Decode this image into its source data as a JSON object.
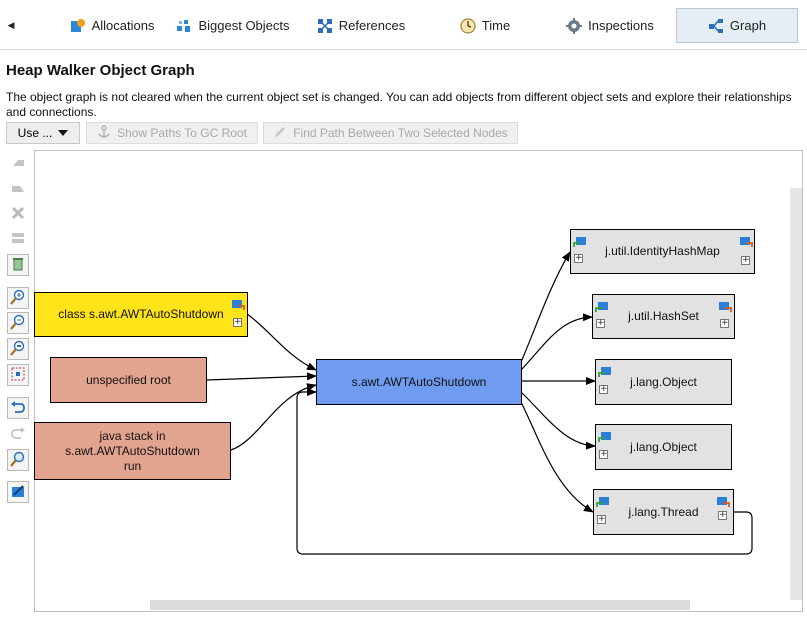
{
  "tabs": [
    {
      "label": "Allocations",
      "icon": "allocations-icon"
    },
    {
      "label": "Biggest Objects",
      "icon": "biggest-objects-icon"
    },
    {
      "label": "References",
      "icon": "references-icon"
    },
    {
      "label": "Time",
      "icon": "clock-icon"
    },
    {
      "label": "Inspections",
      "icon": "gear-icon"
    },
    {
      "label": "Graph",
      "icon": "graph-icon",
      "active": true
    }
  ],
  "page": {
    "title": "Heap Walker Object Graph",
    "description": "The object graph is not cleared when the current object set is changed. You can add objects from different object sets and explore their relationships and connections."
  },
  "toolbar": {
    "use_label": "Use ...",
    "paths_label": "Show Paths To GC Root",
    "find_label": "Find Path Between Two Selected Nodes"
  },
  "side_tools": [
    "back-icon",
    "forward-icon",
    "delete-icon",
    "remove-unselected-icon",
    "clear-graph-icon",
    "zoom-in-icon",
    "zoom-out-icon",
    "zoom-100-icon",
    "fit-content-icon",
    "undo-icon",
    "redo-icon",
    "search-icon",
    "export-icon"
  ],
  "graph": {
    "nodes": {
      "class_awt": "class s.awt.AWTAutoShutdown",
      "unspecified_root": "unspecified root",
      "java_stack_1": "java stack in",
      "java_stack_2": "s.awt.AWTAutoShutdown",
      "java_stack_3": "run",
      "center": "s.awt.AWTAutoShutdown",
      "identity_hash_map": "j.util.IdentityHashMap",
      "hash_set": "j.util.HashSet",
      "object_1": "j.lang.Object",
      "object_2": "j.lang.Object",
      "thread": "j.lang.Thread"
    }
  },
  "colors": {
    "gc_root_class": "#ffe41a",
    "gc_root_other": "#e2a48f",
    "selected_object": "#6f9cf0",
    "object": "#e2e2e2",
    "active_tab": "#e5edf5"
  }
}
